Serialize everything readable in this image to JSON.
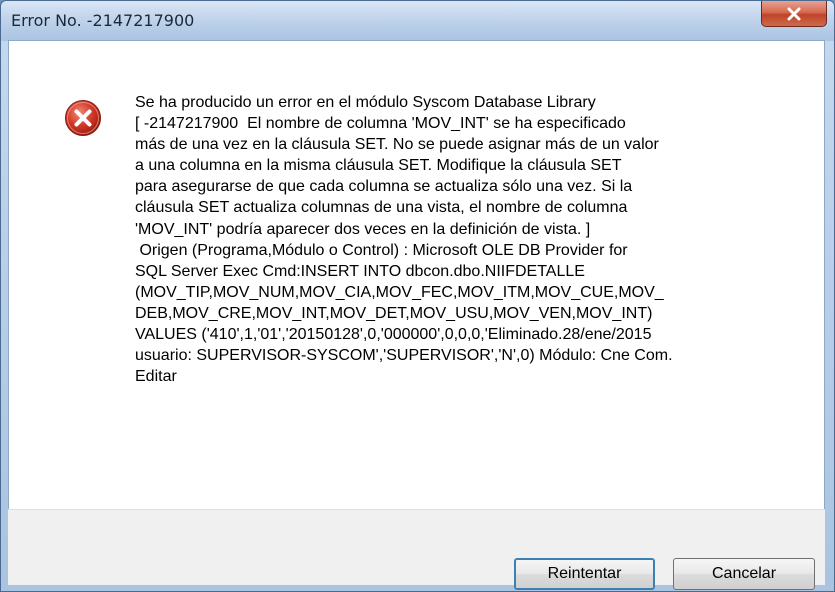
{
  "window": {
    "title": "Error No. -2147217900"
  },
  "icons": {
    "close": "close-icon",
    "error": "error-icon"
  },
  "dialog": {
    "message": "Se ha producido un error en el módulo Syscom Database Library\n[ -2147217900  El nombre de columna 'MOV_INT' se ha especificado\nmás de una vez en la cláusula SET. No se puede asignar más de un valor\na una columna en la misma cláusula SET. Modifique la cláusula SET\npara asegurarse de que cada columna se actualiza sólo una vez. Si la\ncláusula SET actualiza columnas de una vista, el nombre de columna\n'MOV_INT' podría aparecer dos veces en la definición de vista. ]\n Origen (Programa,Módulo o Control) : Microsoft OLE DB Provider for\nSQL Server Exec Cmd:INSERT INTO dbcon.dbo.NIIFDETALLE\n(MOV_TIP,MOV_NUM,MOV_CIA,MOV_FEC,MOV_ITM,MOV_CUE,MOV_\nDEB,MOV_CRE,MOV_INT,MOV_DET,MOV_USU,MOV_VEN,MOV_INT)\nVALUES ('410',1,'01','20150128',0,'000000',0,0,0,'Eliminado.28/ene/2015\nusuario: SUPERVISOR-SYSCOM','SUPERVISOR','N',0) Módulo: Cne Com.\nEditar",
    "buttons": {
      "retry": "Reintentar",
      "cancel": "Cancelar"
    }
  },
  "colors": {
    "titlebar": "#bed2ea",
    "close_button": "#c0452a",
    "error_icon": "#d33b2a",
    "footer": "#f0f0f0"
  }
}
